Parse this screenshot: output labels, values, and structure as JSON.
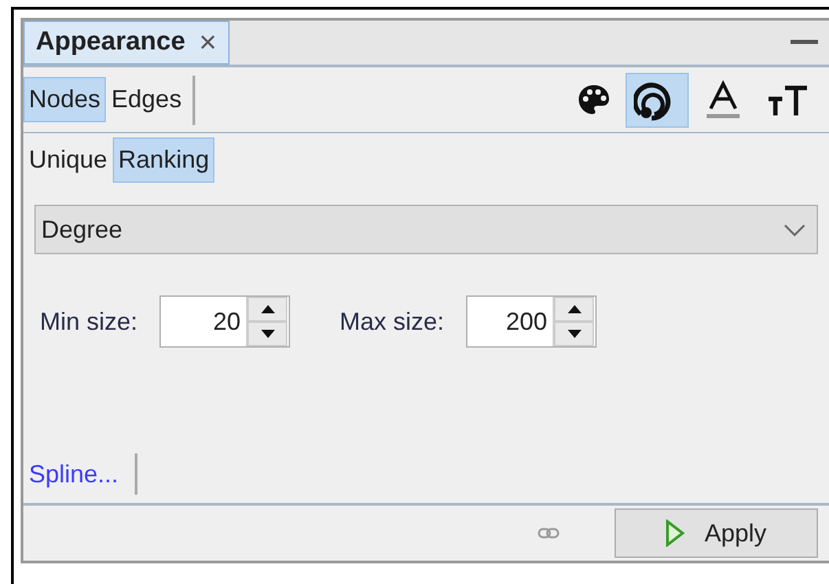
{
  "panel": {
    "title": "Appearance",
    "close": "×"
  },
  "element_tabs": [
    {
      "label": "Nodes",
      "selected": true
    },
    {
      "label": "Edges",
      "selected": false
    }
  ],
  "attribute_tools": [
    {
      "kind": "color",
      "selected": false
    },
    {
      "kind": "size",
      "selected": true
    },
    {
      "kind": "label-color",
      "selected": false
    },
    {
      "kind": "label-size",
      "selected": false
    }
  ],
  "mode_tabs": [
    {
      "label": "Unique",
      "selected": false
    },
    {
      "label": "Ranking",
      "selected": true
    }
  ],
  "attribute_select": {
    "value": "Degree"
  },
  "spinners": [
    {
      "label": "Min size:",
      "value": "20"
    },
    {
      "label": "Max size:",
      "value": "200"
    }
  ],
  "spline_link": "Spline...",
  "apply_button": "Apply"
}
